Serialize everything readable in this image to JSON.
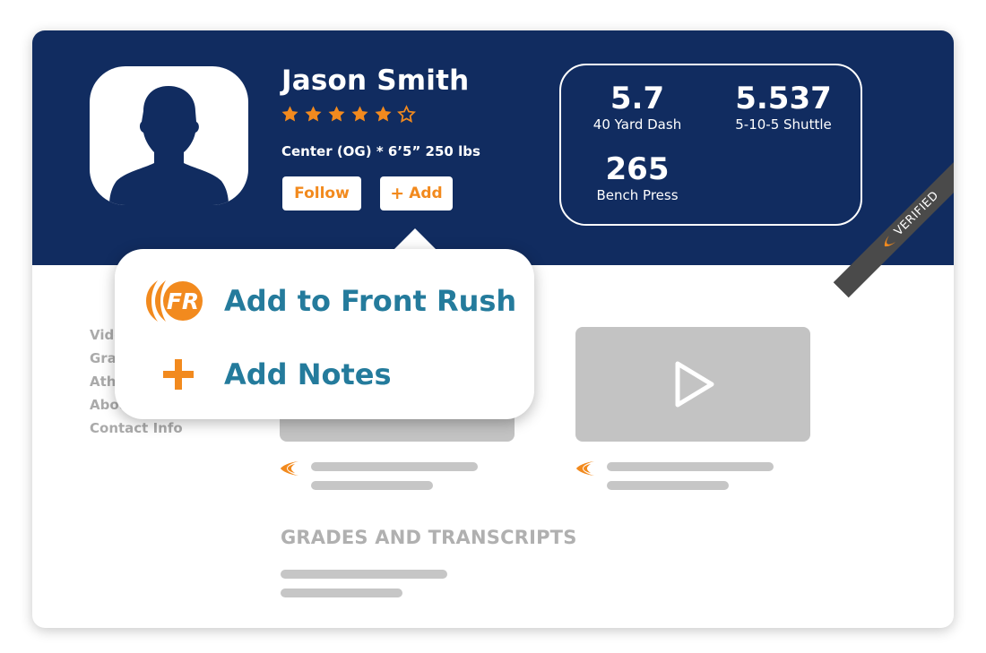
{
  "profile": {
    "name": "Jason Smith",
    "rating": 5,
    "rating_max": 6,
    "position_line": "Center (OG) * 6’5” 250 lbs",
    "follow_label": "Follow",
    "add_plus": "+",
    "add_label": "Add"
  },
  "stats": [
    {
      "value": "5.7",
      "label": "40 Yard Dash"
    },
    {
      "value": "5.537",
      "label": "5-10-5 Shuttle"
    },
    {
      "value": "265",
      "label": "Bench Press"
    }
  ],
  "verified_badge": "VERIFIED",
  "side_nav": {
    "items": [
      "Vide",
      "Grad",
      "Athl",
      "Abou",
      "Contact Info"
    ]
  },
  "popup_menu": {
    "items": [
      {
        "label": "Add to Front Rush",
        "icon": "front-rush-logo-icon"
      },
      {
        "label": "Add Notes",
        "icon": "plus-icon"
      }
    ]
  },
  "sections": {
    "grades_title": "GRADES AND TRANSCRIPTS"
  },
  "colors": {
    "header_bg": "#112c60",
    "accent_orange": "#f28a1e",
    "menu_text": "#247b9c",
    "placeholder_gray": "#c3c3c3"
  }
}
